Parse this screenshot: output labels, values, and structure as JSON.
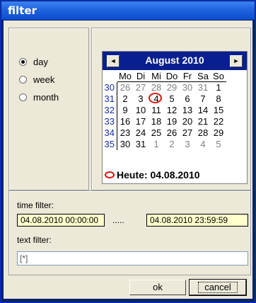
{
  "window": {
    "title": "filter"
  },
  "period": {
    "options": [
      {
        "label": "day",
        "checked": true
      },
      {
        "label": "week",
        "checked": false
      },
      {
        "label": "month",
        "checked": false
      }
    ]
  },
  "calendar": {
    "month_label": "August 2010",
    "prev": "◄",
    "next": "►",
    "weekdays": [
      "Mo",
      "Di",
      "Mi",
      "Do",
      "Fr",
      "Sa",
      "So"
    ],
    "weeks": [
      {
        "week": "30",
        "days": [
          "26",
          "27",
          "28",
          "29",
          "30",
          "31",
          "1"
        ],
        "other": [
          true,
          true,
          true,
          true,
          true,
          true,
          false
        ]
      },
      {
        "week": "31",
        "days": [
          "2",
          "3",
          "4",
          "5",
          "6",
          "7",
          "8"
        ],
        "other": [
          false,
          false,
          false,
          false,
          false,
          false,
          false
        ]
      },
      {
        "week": "32",
        "days": [
          "9",
          "10",
          "11",
          "12",
          "13",
          "14",
          "15"
        ],
        "other": [
          false,
          false,
          false,
          false,
          false,
          false,
          false
        ]
      },
      {
        "week": "33",
        "days": [
          "16",
          "17",
          "18",
          "19",
          "20",
          "21",
          "22"
        ],
        "other": [
          false,
          false,
          false,
          false,
          false,
          false,
          false
        ]
      },
      {
        "week": "34",
        "days": [
          "23",
          "24",
          "25",
          "26",
          "27",
          "28",
          "29"
        ],
        "other": [
          false,
          false,
          false,
          false,
          false,
          false,
          false
        ]
      },
      {
        "week": "35",
        "days": [
          "30",
          "31",
          "1",
          "2",
          "3",
          "4",
          "5"
        ],
        "other": [
          false,
          false,
          true,
          true,
          true,
          true,
          true
        ]
      }
    ],
    "selected_day": "4",
    "today_label": "Heute: 04.08.2010"
  },
  "filters": {
    "time_label": "time filter:",
    "from": "04.08.2010 00:00:00",
    "separator": ".....",
    "to": "04.08.2010 23:59:59",
    "text_label": "text filter:",
    "text_value": "[*]"
  },
  "buttons": {
    "ok": "ok",
    "cancel": "cancel"
  },
  "colors": {
    "title_bar": "#1f63de",
    "calendar_header": "#0a1f8f",
    "field_bg": "#ffffcc",
    "today_marker": "#e01010"
  }
}
